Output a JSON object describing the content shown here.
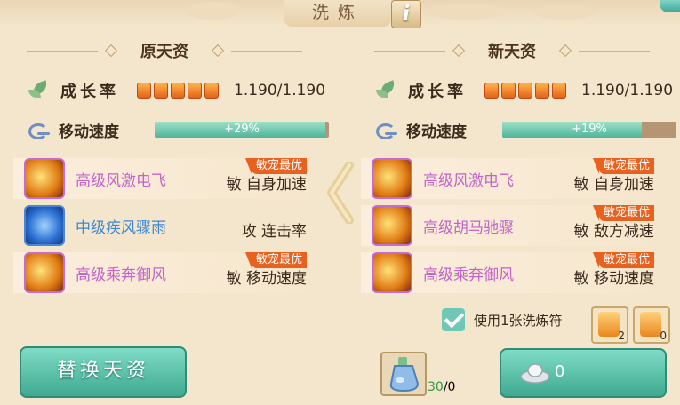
{
  "header": {
    "title": "洗炼",
    "info_icon": "info-icon"
  },
  "left": {
    "heading": "原天资",
    "growth": {
      "label": "成长率",
      "stars": 5,
      "value": "1.190/1.190"
    },
    "speed": {
      "label": "移动速度",
      "fill": 0.98,
      "text": "+29%"
    },
    "skills": [
      {
        "name": "高级风激电飞",
        "effect": "敏 自身加速",
        "tag": "敏宠最优",
        "tier": "purple",
        "highlight": true
      },
      {
        "name": "中级疾风骤雨",
        "effect": "攻 连击率",
        "tag": "",
        "tier": "blue",
        "highlight": false
      },
      {
        "name": "高级乘奔御风",
        "effect": "敏 移动速度",
        "tag": "敏宠最优",
        "tier": "purple",
        "highlight": true
      }
    ]
  },
  "right": {
    "heading": "新天资",
    "growth": {
      "label": "成长率",
      "stars": 5,
      "value": "1.190/1.190"
    },
    "speed": {
      "label": "移动速度",
      "fill": 0.8,
      "text": "+19%"
    },
    "skills": [
      {
        "name": "高级风激电飞",
        "effect": "敏 自身加速",
        "tag": "敏宠最优",
        "tier": "purple",
        "highlight": true
      },
      {
        "name": "高级胡马驰骤",
        "effect": "敏 敌方减速",
        "tag": "敏宠最优",
        "tier": "purple",
        "highlight": true
      },
      {
        "name": "高级乘奔御风",
        "effect": "敏 移动速度",
        "tag": "敏宠最优",
        "tier": "purple",
        "highlight": true
      }
    ]
  },
  "use_talisman": {
    "checked": true,
    "label": "使用1张洗炼符"
  },
  "talismans": [
    {
      "count": "2"
    },
    {
      "count": "0"
    }
  ],
  "buttons": {
    "replace": "替换天资",
    "cost": "0"
  },
  "potion": {
    "have": "30",
    "need": "/0"
  },
  "colors": {
    "accent_teal": "#4fb59a",
    "tag_orange": "#e8611f",
    "purple_skill": "#c264c8",
    "blue_skill": "#3c88d8"
  }
}
